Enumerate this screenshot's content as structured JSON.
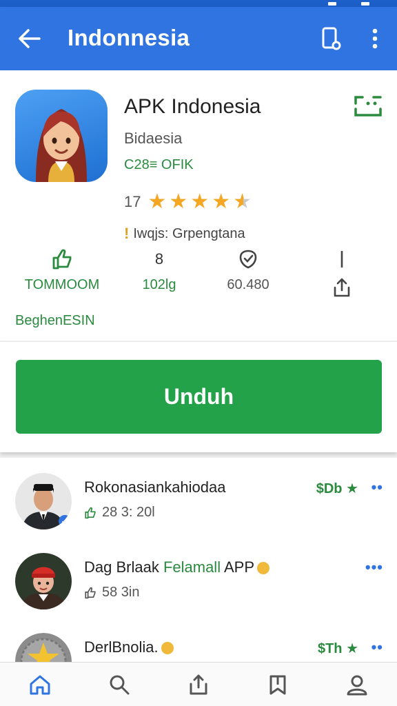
{
  "appbar": {
    "title": "Indonnesia",
    "back_icon": "arrow-left-icon",
    "action1_icon": "device-icon",
    "action2_icon": "more-vert-icon",
    "color": "#2f74e0"
  },
  "app": {
    "name": "APK Indonesia",
    "developer": "Bidaesia",
    "size": "C28≡ OFIK",
    "rating": {
      "label": "17",
      "value": 4.5,
      "max": 5
    },
    "language_line": "Iwqjs: Grpengtana",
    "stats": [
      {
        "icon": "thumb-up-icon",
        "value": "TOMMOOM"
      },
      {
        "icon": "count-icon",
        "top": "8",
        "value": "102lg"
      },
      {
        "icon": "shield-check-icon",
        "value": "60.480"
      },
      {
        "icon": "share-icon",
        "value": ""
      }
    ],
    "link_text": "BeghenESIN"
  },
  "download": {
    "label": "Unduh",
    "color": "#23a24a"
  },
  "list": [
    {
      "name": "Rokonasiankahiodaa",
      "sub": "28 3: 20l",
      "price": "$Db ★",
      "more": "••",
      "avatar": "person-suit-avatar"
    },
    {
      "name_main": "Dag Brlaak ",
      "name_hl": "Felamall",
      "name_tail": " APP",
      "sub": "58 3in",
      "more": "•••",
      "avatar": "person-red-hat-avatar"
    },
    {
      "name": "DerlBnolia.",
      "price": "$Th ★",
      "more": "••",
      "avatar": "coin-avatar"
    }
  ],
  "bottom_nav": [
    "home-icon",
    "search-icon",
    "share-icon",
    "bookmark-icon",
    "profile-icon"
  ]
}
